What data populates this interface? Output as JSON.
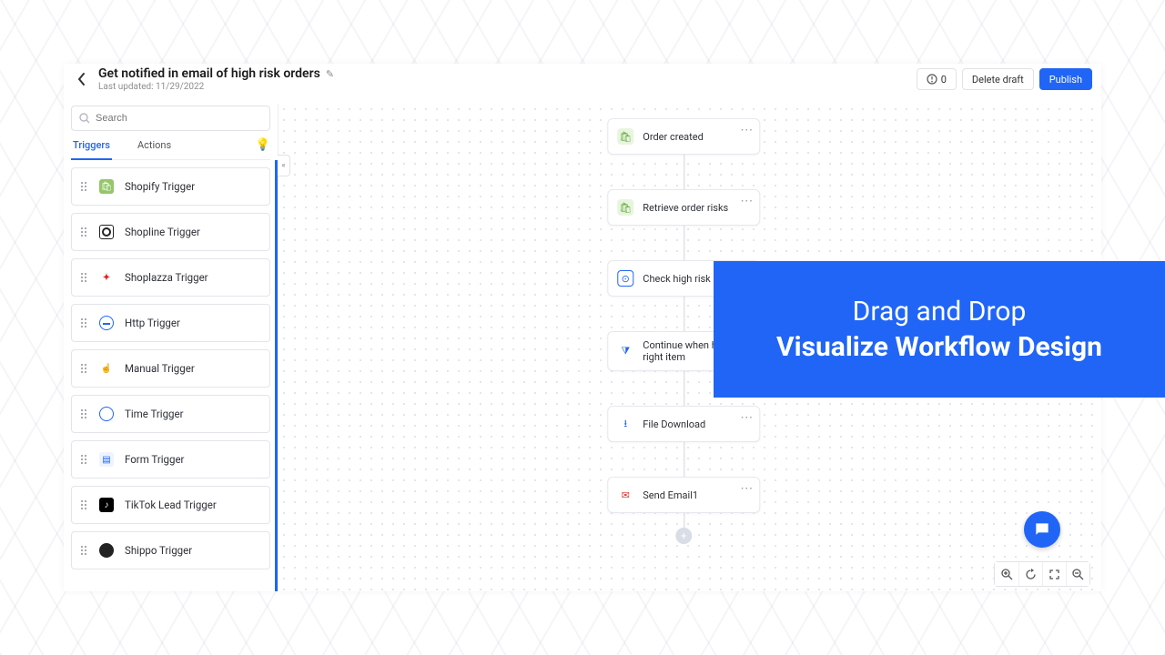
{
  "header": {
    "title": "Get notified in email of high risk orders",
    "last_updated_label": "Last updated: 11/29/2022",
    "error_count": "0",
    "delete_label": "Delete draft",
    "publish_label": "Publish"
  },
  "search": {
    "placeholder": "Search"
  },
  "tabs": {
    "triggers": "Triggers",
    "actions": "Actions"
  },
  "triggers": [
    {
      "label": "Shopify Trigger",
      "icon": "shopify"
    },
    {
      "label": "Shopline Trigger",
      "icon": "shopline"
    },
    {
      "label": "Shoplazza Trigger",
      "icon": "shoplazza"
    },
    {
      "label": "Http Trigger",
      "icon": "http"
    },
    {
      "label": "Manual Trigger",
      "icon": "manual"
    },
    {
      "label": "Time Trigger",
      "icon": "time"
    },
    {
      "label": "Form Trigger",
      "icon": "form"
    },
    {
      "label": "TikTok Lead Trigger",
      "icon": "tiktok"
    },
    {
      "label": "Shippo Trigger",
      "icon": "shippo"
    }
  ],
  "nodes": [
    {
      "label": "Order created",
      "icon": "shopify"
    },
    {
      "label": "Retrieve order risks",
      "icon": "shopify"
    },
    {
      "label": "Check high risk",
      "icon": "check"
    },
    {
      "label": "Continue when has high right item",
      "icon": "filter"
    },
    {
      "label": "File Download",
      "icon": "download"
    },
    {
      "label": "Send Email1",
      "icon": "mail"
    }
  ],
  "banner": {
    "line1": "Drag and Drop",
    "line2": "Visualize Workflow Design"
  },
  "icons": {
    "shopify_glyph": "🛍",
    "shoplazza_glyph": "✦",
    "manual_glyph": "☝",
    "form_glyph": "▤",
    "tiktok_glyph": "♪",
    "check_glyph": "⊙",
    "filter_glyph": "⧩",
    "download_glyph": "⭳",
    "mail_glyph": "✉"
  }
}
